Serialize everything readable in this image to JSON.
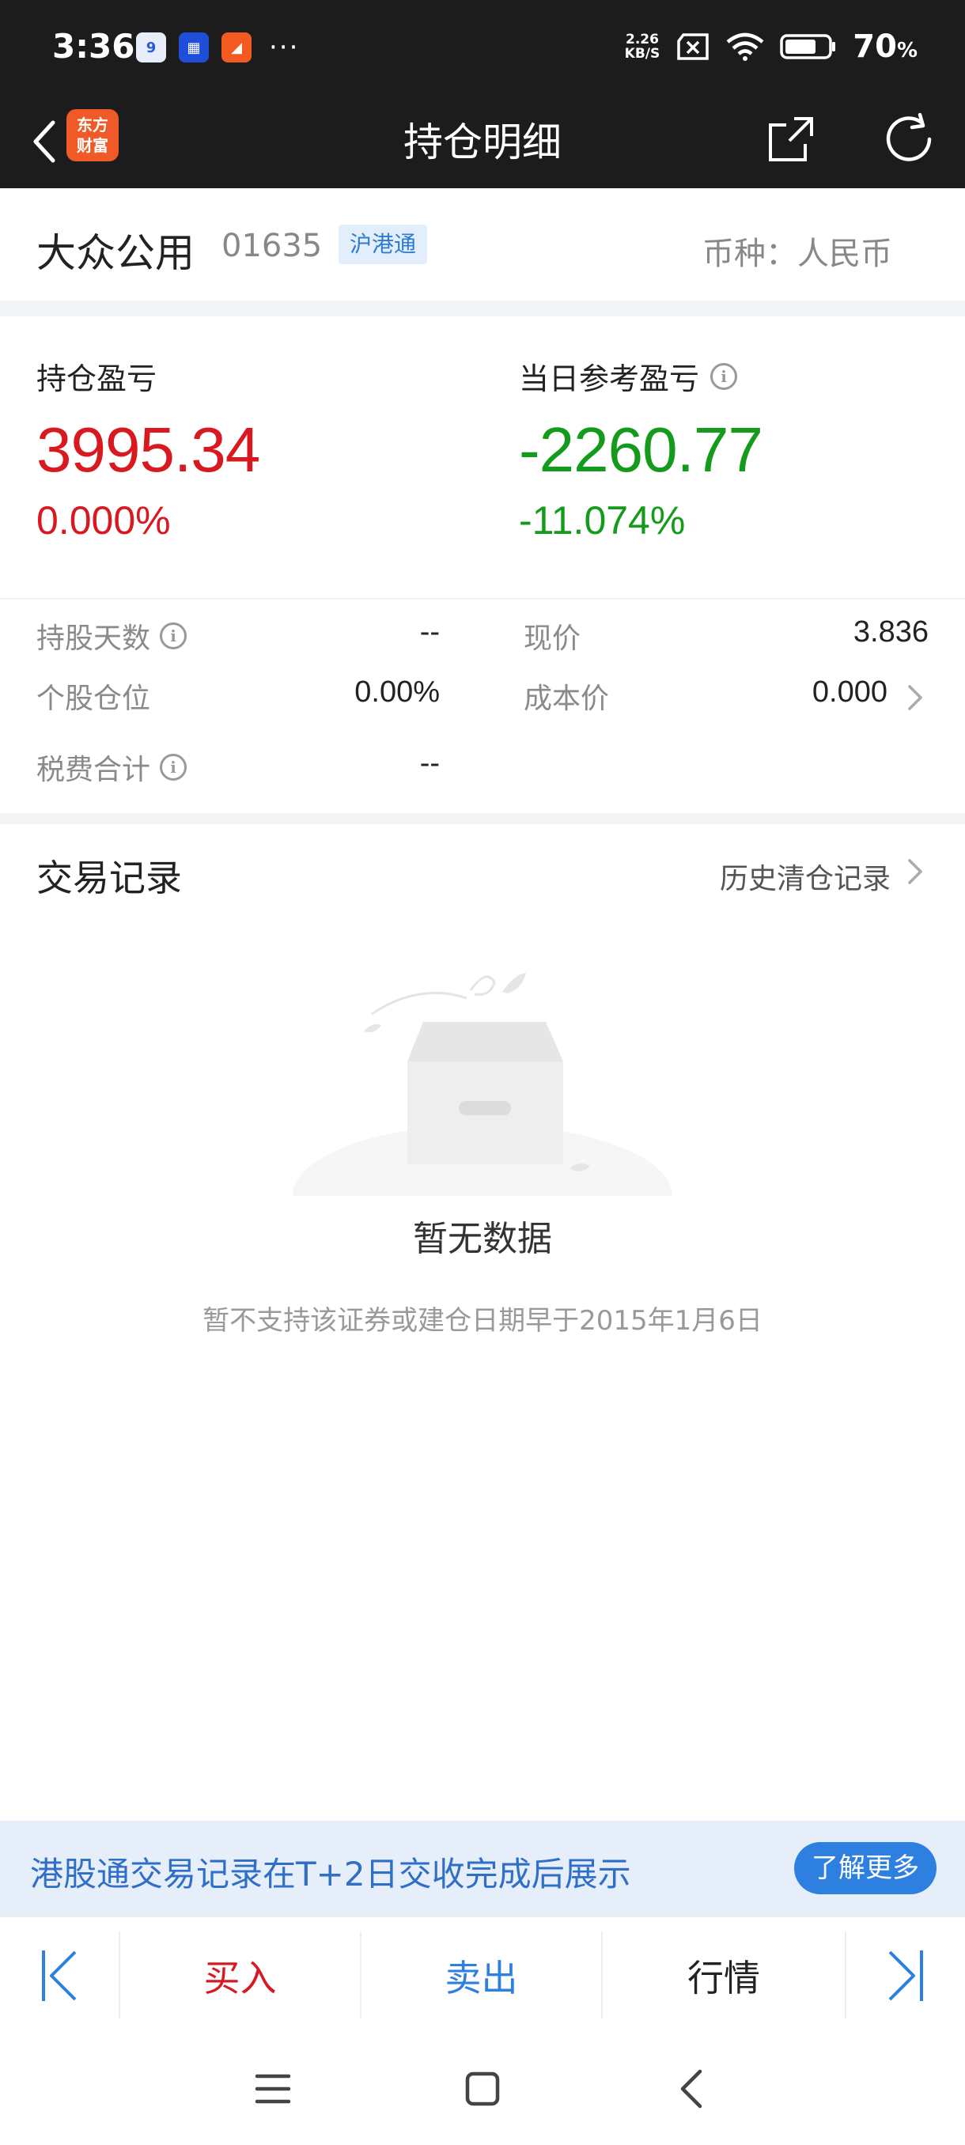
{
  "status_bar": {
    "time": "3:36",
    "app_icons": [
      {
        "name": "app-icon-1",
        "label": "9",
        "color": "#e8eef9",
        "fg": "#2a5bd7"
      },
      {
        "name": "app-icon-2",
        "label": "▦",
        "color": "#1f4fd8",
        "fg": "#ffffff"
      },
      {
        "name": "app-icon-3",
        "label": "◢",
        "color": "#f25a22",
        "fg": "#ffffff"
      }
    ],
    "more": "···",
    "net_speed_top": "2.26",
    "net_speed_bottom": "KB/S",
    "battery": "70",
    "battery_unit": "%"
  },
  "nav": {
    "logo_line1": "东方",
    "logo_line2": "财富",
    "title": "持仓明细"
  },
  "stock": {
    "name": "大众公用",
    "code": "01635",
    "badge": "沪港通",
    "currency": "币种：人民币"
  },
  "pnl": {
    "position_label": "持仓盈亏",
    "position_value": "3995.34",
    "position_pct": "0.000%",
    "daily_label": "当日参考盈亏",
    "daily_value": "-2260.77",
    "daily_pct": "-11.074%"
  },
  "details": {
    "hold_days_label": "持股天数",
    "hold_days_value": "--",
    "price_label": "现价",
    "price_value": "3.836",
    "position_ratio_label": "个股仓位",
    "position_ratio_value": "0.00%",
    "cost_label": "成本价",
    "cost_value": "0.000",
    "tax_label": "税费合计",
    "tax_value": "--"
  },
  "trade": {
    "title": "交易记录",
    "history_link": "历史清仓记录"
  },
  "empty": {
    "message": "暂无数据",
    "sub": "暂不支持该证券或建仓日期早于2015年1月6日"
  },
  "notice": {
    "text": "港股通交易记录在T+2日交收完成后展示",
    "button": "了解更多"
  },
  "actions": {
    "buy": "买入",
    "sell": "卖出",
    "quote": "行情"
  },
  "colors": {
    "red": "#d8191f",
    "green": "#159b1c",
    "blue": "#2d7fe0"
  }
}
